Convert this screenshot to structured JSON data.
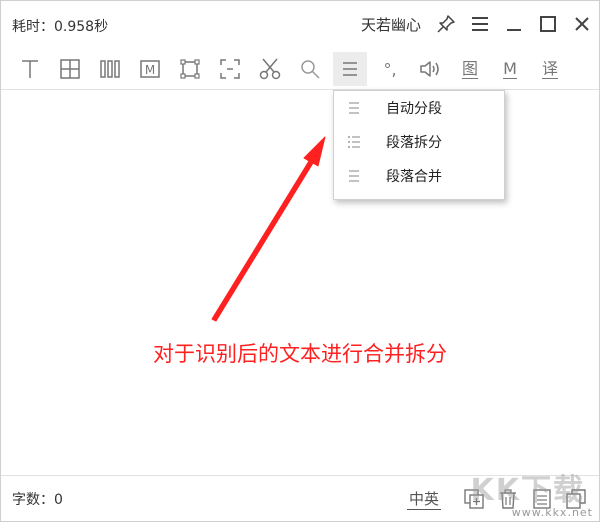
{
  "titlebar": {
    "elapsed": "耗时：0.958秒",
    "user_name": "天若幽心"
  },
  "toolbar": {
    "text_m": "M",
    "degree": "°,",
    "image_label": "图",
    "m_label": "M",
    "translate_label": "译"
  },
  "menu": {
    "items": [
      {
        "label": "自动分段"
      },
      {
        "label": "段落拆分"
      },
      {
        "label": "段落合并"
      }
    ]
  },
  "annotation": "对于识别后的文本进行合并拆分",
  "statusbar": {
    "char_count": "字数：0",
    "lang_toggle": "中英"
  },
  "watermark": {
    "big": "KK下载",
    "url": "www.kkx.net"
  },
  "colors": {
    "annotation": "#ff2020",
    "icon": "#777777"
  }
}
